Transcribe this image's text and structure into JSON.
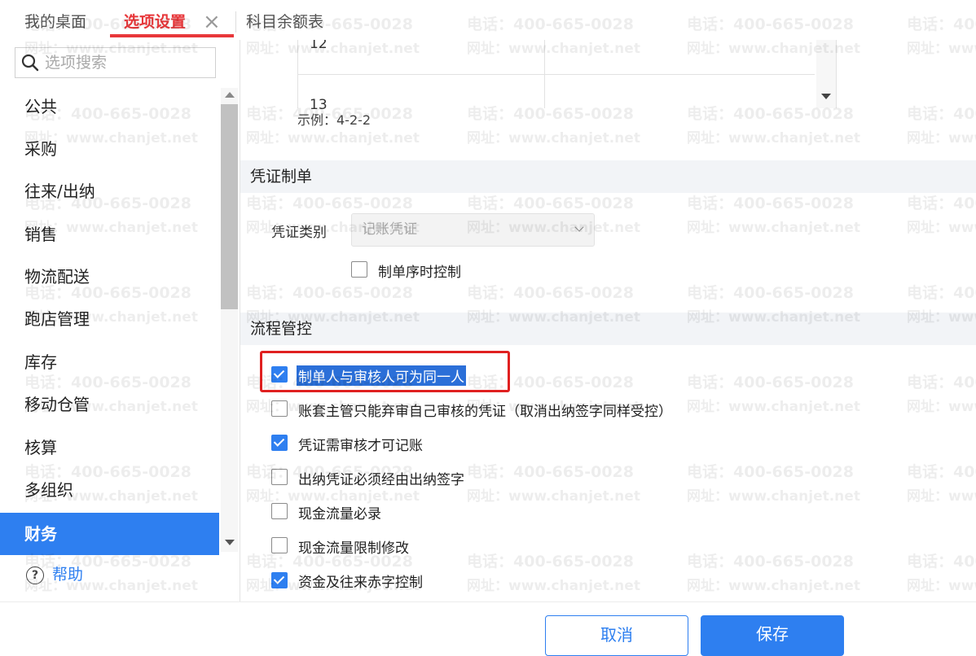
{
  "tabs": [
    {
      "label": "我的桌面"
    },
    {
      "label": "选项设置"
    },
    {
      "label": "科目余额表"
    }
  ],
  "sidebar": {
    "search_placeholder": "选项搜索",
    "items": [
      {
        "label": "公共"
      },
      {
        "label": "采购"
      },
      {
        "label": "往来/出纳"
      },
      {
        "label": "销售"
      },
      {
        "label": "物流配送"
      },
      {
        "label": "跑店管理"
      },
      {
        "label": "库存"
      },
      {
        "label": "移动仓管"
      },
      {
        "label": "核算"
      },
      {
        "label": "多组织"
      },
      {
        "label": "财务",
        "active": true
      }
    ],
    "help_label": "帮助"
  },
  "grid": {
    "rows": [
      "12",
      "13"
    ]
  },
  "example_text": "示例：4-2-2",
  "voucher_section": {
    "title": "凭证制单",
    "type_label": "凭证类别",
    "type_value": "记账凭证",
    "options": [
      {
        "label": "制单序时控制",
        "checked": false
      }
    ]
  },
  "process_section": {
    "title": "流程管控",
    "options": [
      {
        "label": "制单人与审核人可为同一人",
        "checked": true,
        "selected": true
      },
      {
        "label": "账套主管只能弃审自己审核的凭证（取消出纳签字同样受控）",
        "checked": false
      },
      {
        "label": "凭证需审核才可记账",
        "checked": true
      },
      {
        "label": "出纳凭证必须经由出纳签字",
        "checked": false
      },
      {
        "label": "现金流量必录",
        "checked": false
      },
      {
        "label": "现金流量限制修改",
        "checked": false
      },
      {
        "label": "资金及往来赤字控制",
        "checked": true
      }
    ]
  },
  "footer": {
    "cancel_label": "取消",
    "save_label": "保存"
  },
  "watermark": {
    "phone": "电话：400-665-0028",
    "site": "网址：www.chanjet.net"
  },
  "colors": {
    "accent": "#2e7ff0",
    "active_tab": "#e8373a",
    "highlight_box": "#e02020"
  }
}
